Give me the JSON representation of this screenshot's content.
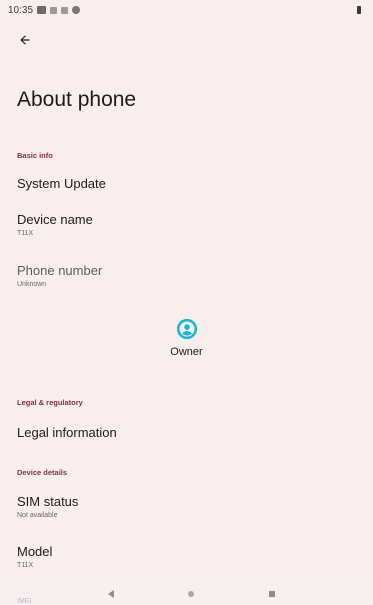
{
  "status_bar": {
    "time": "10:35"
  },
  "header": {
    "title": "About phone"
  },
  "sections": {
    "basic_info": "Basic info",
    "legal": "Legal & regulatory",
    "device_details": "Device details"
  },
  "items": {
    "system_update": {
      "title": "System Update"
    },
    "device_name": {
      "title": "Device name",
      "summary": "T11X"
    },
    "phone_number": {
      "title": "Phone number",
      "summary": "Unknown"
    },
    "legal_information": {
      "title": "Legal information"
    },
    "sim_status": {
      "title": "SIM status",
      "summary": "Not available"
    },
    "model": {
      "title": "Model",
      "summary": "T11X"
    }
  },
  "owner": {
    "label": "Owner",
    "accent_color": "#17b6d3"
  },
  "partial_text": "IMEI",
  "icons": {
    "back": "arrow-left-icon",
    "owner": "account-circle-icon",
    "nav_back": "triangle-left-icon",
    "nav_home": "circle-icon",
    "nav_recents": "square-icon"
  },
  "colors": {
    "background": "#f9eeee",
    "section_header": "#8a2c4e",
    "accent": "#17b6d3"
  }
}
